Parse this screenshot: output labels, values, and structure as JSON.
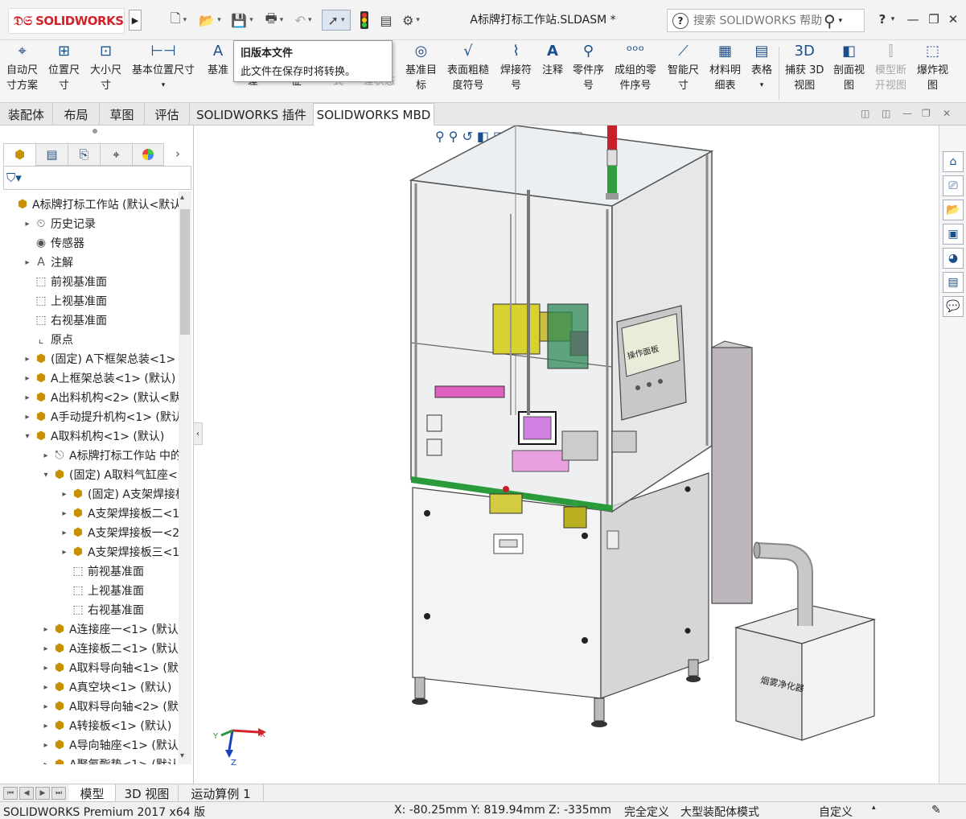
{
  "app": {
    "logo_text": "SOLIDWORKS",
    "doc_title": "A标牌打标工作站.SLDASM *",
    "help_placeholder": "搜索 SOLIDWORKS 帮助"
  },
  "tooltip": {
    "title": "旧版本文件",
    "desc": "此文件在保存时将转换。"
  },
  "ribbon": {
    "auto_dim_1": "自动尺",
    "auto_dim_2": "寸方案",
    "loc_dim_1": "位置尺",
    "loc_dim_2": "寸",
    "size_dim_1": "大小尺",
    "size_dim_2": "寸",
    "basic_loc": "基本位置尺寸",
    "datum_1": "基准",
    "hidden_1": "差",
    "hidden_2": "征",
    "hidden_3": "式",
    "hidden_4": "差状态",
    "datum_target_1": "基准目",
    "datum_target_2": "标",
    "surface_1": "表面粗糙",
    "surface_2": "度符号",
    "weld_1": "焊接符",
    "weld_2": "号",
    "note": "注释",
    "balloon_1": "零件序",
    "balloon_2": "号",
    "auto_balloon_1": "成组的零",
    "auto_balloon_2": "件序号",
    "smart_dim_1": "智能尺",
    "smart_dim_2": "寸",
    "bom_1": "材料明",
    "bom_2": "细表",
    "table": "表格",
    "capture_1": "捕获 3D",
    "capture_2": "视图",
    "section_1": "剖面视",
    "section_2": "图",
    "model_break_1": "模型断",
    "model_break_2": "开视图",
    "explode_1": "爆炸视",
    "explode_2": "图"
  },
  "tabs": [
    "装配体",
    "布局",
    "草图",
    "评估",
    "SOLIDWORKS 插件",
    "SOLIDWORKS MBD"
  ],
  "active_tab": "SOLIDWORKS MBD",
  "tree": [
    {
      "label": "A标牌打标工作站  (默认<默认",
      "icon": "assembly-icon",
      "indent": 0,
      "exp": ""
    },
    {
      "label": "历史记录",
      "icon": "history-icon",
      "indent": 1,
      "exp": "▸"
    },
    {
      "label": "传感器",
      "icon": "sensor-icon",
      "indent": 1,
      "exp": ""
    },
    {
      "label": "注解",
      "icon": "annotation-icon",
      "indent": 1,
      "exp": "▸"
    },
    {
      "label": "前视基准面",
      "icon": "plane-icon",
      "indent": 1,
      "exp": ""
    },
    {
      "label": "上视基准面",
      "icon": "plane-icon",
      "indent": 1,
      "exp": ""
    },
    {
      "label": "右视基准面",
      "icon": "plane-icon",
      "indent": 1,
      "exp": ""
    },
    {
      "label": "原点",
      "icon": "origin-icon",
      "indent": 1,
      "exp": ""
    },
    {
      "label": "(固定) A下框架总装<1> (",
      "icon": "subassembly-icon",
      "indent": 1,
      "exp": "▸"
    },
    {
      "label": "A上框架总装<1> (默认)",
      "icon": "subassembly-icon",
      "indent": 1,
      "exp": "▸"
    },
    {
      "label": "A出料机构<2> (默认<默认",
      "icon": "subassembly-icon",
      "indent": 1,
      "exp": "▸"
    },
    {
      "label": "A手动提升机构<1> (默认",
      "icon": "subassembly-icon",
      "indent": 1,
      "exp": "▸"
    },
    {
      "label": "A取料机构<1> (默认)",
      "icon": "subassembly-icon",
      "indent": 1,
      "exp": "▾"
    },
    {
      "label": "A标牌打标工作站 中的",
      "icon": "mate-folder-icon",
      "indent": 2,
      "exp": "▸"
    },
    {
      "label": "(固定) A取料气缸座<1",
      "icon": "subassembly-icon",
      "indent": 2,
      "exp": "▾"
    },
    {
      "label": "(固定) A支架焊接板",
      "icon": "part-icon",
      "indent": 3,
      "exp": "▸"
    },
    {
      "label": "A支架焊接板二<1:",
      "icon": "part-icon",
      "indent": 3,
      "exp": "▸"
    },
    {
      "label": "A支架焊接板一<2:",
      "icon": "part-icon",
      "indent": 3,
      "exp": "▸"
    },
    {
      "label": "A支架焊接板三<1:",
      "icon": "part-icon",
      "indent": 3,
      "exp": "▸"
    },
    {
      "label": "前视基准面",
      "icon": "plane-icon",
      "indent": 3,
      "exp": ""
    },
    {
      "label": "上视基准面",
      "icon": "plane-icon",
      "indent": 3,
      "exp": ""
    },
    {
      "label": "右视基准面",
      "icon": "plane-icon",
      "indent": 3,
      "exp": ""
    },
    {
      "label": "A连接座一<1> (默认)",
      "icon": "part-icon",
      "indent": 2,
      "exp": "▸"
    },
    {
      "label": "A连接板二<1> (默认)",
      "icon": "part-icon",
      "indent": 2,
      "exp": "▸"
    },
    {
      "label": "A取料导向轴<1> (默认",
      "icon": "part-icon",
      "indent": 2,
      "exp": "▸"
    },
    {
      "label": "A真空块<1> (默认)",
      "icon": "part-icon",
      "indent": 2,
      "exp": "▸"
    },
    {
      "label": "A取料导向轴<2> (默认",
      "icon": "part-icon",
      "indent": 2,
      "exp": "▸"
    },
    {
      "label": "A转接板<1> (默认)",
      "icon": "part-icon",
      "indent": 2,
      "exp": "▸"
    },
    {
      "label": "A导向轴座<1> (默认)",
      "icon": "part-icon",
      "indent": 2,
      "exp": "▸"
    },
    {
      "label": "A聚氨酯垫<1> (默认)",
      "icon": "part-icon",
      "indent": 2,
      "exp": "▸"
    }
  ],
  "bottom_tabs": [
    "模型",
    "3D 视图",
    "运动算例 1"
  ],
  "status": {
    "version": "SOLIDWORKS Premium 2017 x64 版",
    "coords": "X: -80.25mm Y: 819.94mm Z: -335mm",
    "define": "完全定义",
    "mode": "大型装配体模式",
    "custom": "自定义"
  },
  "model_labels": {
    "panel_text": "操作面板",
    "filter_text": "烟雾净化器"
  },
  "triad": {
    "x": "X",
    "y": "Y",
    "z": "Z"
  },
  "colors": {
    "brand": "#d2232a",
    "ribbon_icon": "#1a4f8c"
  }
}
